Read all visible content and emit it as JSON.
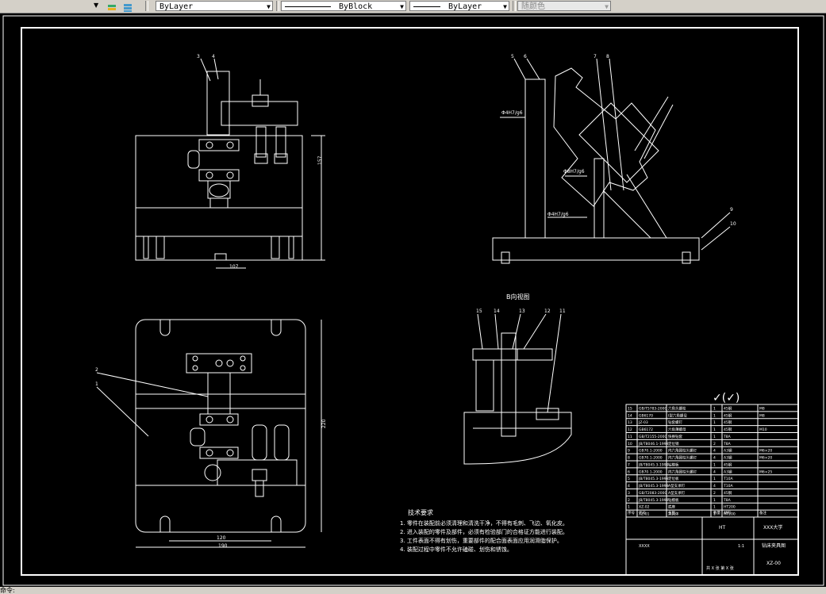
{
  "toolbar": {
    "layer_value": "ByLayer",
    "linetype_value": "ByBlock",
    "lineweight_value": "ByLayer",
    "color_value": "随颜色"
  },
  "drawing": {
    "dim_height": "157",
    "dim_bottom": "107",
    "dim_plan_width": "190",
    "dim_plan_inner": "120",
    "dim_plan_height": "220",
    "dim_side_1": "Φ4H7/g6",
    "dim_side_2": "Φ8H7/g6",
    "dim_side_3": "Φ4H7/g6",
    "view_label": "B向视图",
    "balloons_front": [
      "3",
      "4"
    ],
    "balloons_side": [
      "5",
      "6",
      "7",
      "8",
      "9",
      "10"
    ],
    "balloons_detail": [
      "15",
      "14",
      "13",
      "12",
      "11"
    ],
    "balloons_plan": [
      "2",
      "1"
    ],
    "roughness": "✓(✓)"
  },
  "notes": {
    "title": "技术要求",
    "items": [
      "1. 零件在装配前必须清理和清洗干净，不得有毛刺、飞边、氧化皮。",
      "2. 进入装配的零件及部件，必须有检验部门的合格证方能进行装配。",
      "3. 工件表面不得有划伤，重要部件的配合面表面应用润滑脂保护。",
      "4. 装配过程中零件不允许磕碰、划伤和锈蚀。"
    ]
  },
  "bom": {
    "rows": [
      {
        "no": "15",
        "code": "GB/T5783-2000",
        "name": "六角头螺栓",
        "qty": "1",
        "mat": "45钢",
        "note": "M8"
      },
      {
        "no": "14",
        "code": "GB6170",
        "name": "I型六角螺母",
        "qty": "1",
        "mat": "45钢",
        "note": "M8"
      },
      {
        "no": "13",
        "code": "JZ-03",
        "name": "钻套螺钉",
        "qty": "1",
        "mat": "45钢",
        "note": ""
      },
      {
        "no": "12",
        "code": "GB6172",
        "name": "六角薄螺母",
        "qty": "1",
        "mat": "45钢",
        "note": "M10"
      },
      {
        "no": "11",
        "code": "GB/T2155-2000",
        "name": "快换钻套",
        "qty": "1",
        "mat": "T8A",
        "note": ""
      },
      {
        "no": "10",
        "code": "JB/T8046.1-1999",
        "name": "定位销",
        "qty": "2",
        "mat": "T8A",
        "note": ""
      },
      {
        "no": "9",
        "code": "GB70.1-2000",
        "name": "内六角圆柱头螺钉",
        "qty": "4",
        "mat": "A3钢",
        "note": "M6×20"
      },
      {
        "no": "8",
        "code": "GB70.1-2000",
        "name": "内六角圆柱头螺钉",
        "qty": "4",
        "mat": "A3钢",
        "note": "M6×20"
      },
      {
        "no": "7",
        "code": "JB/T8045.3-1999",
        "name": "钻模板",
        "qty": "1",
        "mat": "45钢",
        "note": ""
      },
      {
        "no": "6",
        "code": "GB70.1-2000",
        "name": "内六角圆柱头螺钉",
        "qty": "4",
        "mat": "A3钢",
        "note": "M6×25"
      },
      {
        "no": "5",
        "code": "JB/T8045.3-1999",
        "name": "定位板",
        "qty": "1",
        "mat": "T10A",
        "note": ""
      },
      {
        "no": "4",
        "code": "JB/T8045.3-1999",
        "name": "A型支承钉",
        "qty": "4",
        "mat": "T10A",
        "note": ""
      },
      {
        "no": "3",
        "code": "GB/T2083-2000",
        "name": "A型支承钉",
        "qty": "2",
        "mat": "45钢",
        "note": ""
      },
      {
        "no": "2",
        "code": "JB/T8045.3-1999",
        "name": "钻模板",
        "qty": "1",
        "mat": "T8A",
        "note": ""
      },
      {
        "no": "1",
        "code": "XZ-02",
        "name": "底座",
        "qty": "1",
        "mat": "HT200",
        "note": ""
      },
      {
        "no": "",
        "code": "XZ-01",
        "name": "夹具体",
        "qty": "1",
        "mat": "HT200",
        "note": ""
      }
    ],
    "header": {
      "no": "序号",
      "code": "代号",
      "name": "名称",
      "qty": "数量",
      "mat": "材料",
      "note": "备注"
    }
  },
  "title_block": {
    "material": "HT",
    "school": "XXX大学",
    "drawing_name": "钻床夹具图",
    "drawing_no": "XZ-00",
    "scale": "1:1",
    "designer": "XXXX",
    "sheet": "共 X 张  第 X 张",
    "labels": [
      "标记",
      "处数",
      "分区",
      "更改文件号",
      "签名",
      "年月日",
      "设计",
      "审核",
      "工艺",
      "批准",
      "阶段标记",
      "重量",
      "比例"
    ]
  },
  "status": {
    "prompt": "命令:"
  },
  "colors": {
    "background": "#000000",
    "lines": "#ffffff",
    "toolbar": "#d4d0c8"
  }
}
